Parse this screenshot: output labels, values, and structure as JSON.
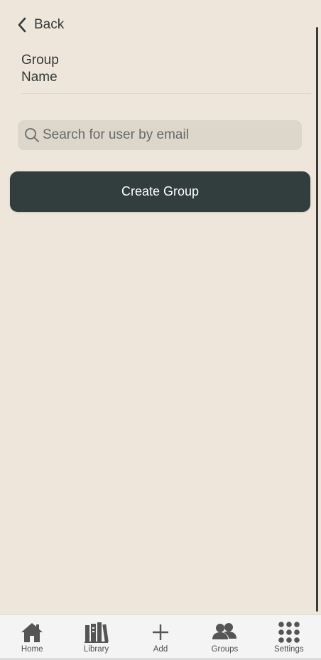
{
  "header": {
    "back_label": "Back"
  },
  "form": {
    "group_name_placeholder": "Group Name",
    "search_placeholder": "Search for user by email",
    "search_value": "",
    "create_button_label": "Create Group"
  },
  "tab_bar": {
    "items": [
      {
        "label": "Home",
        "icon": "home-icon"
      },
      {
        "label": "Library",
        "icon": "library-icon"
      },
      {
        "label": "Add",
        "icon": "plus-icon"
      },
      {
        "label": "Groups",
        "icon": "groups-icon"
      },
      {
        "label": "Settings",
        "icon": "grid-icon"
      }
    ]
  },
  "colors": {
    "background": "#eee6da",
    "primary_button": "#313e3d",
    "search_field": "#ddd6ca",
    "tab_bar": "#f4f4f5",
    "icon": "#555555"
  }
}
